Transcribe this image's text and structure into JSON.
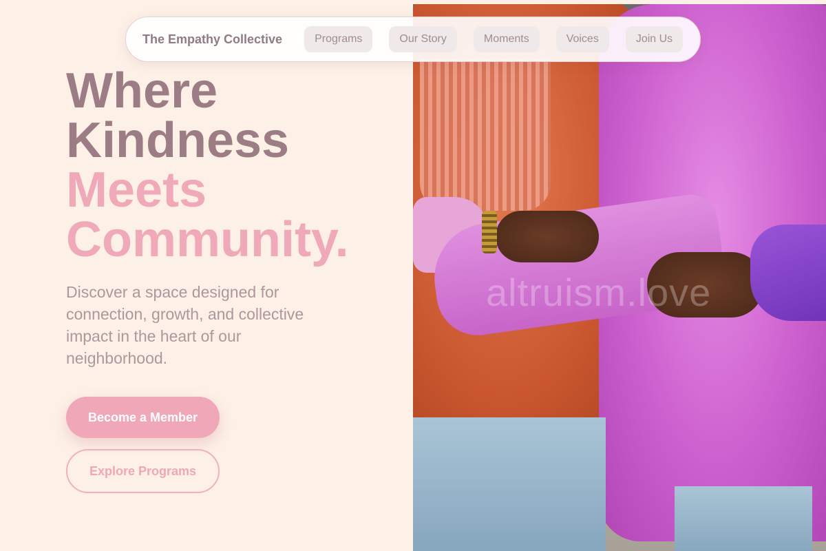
{
  "nav": {
    "brand": "The Empathy Collective",
    "links": [
      "Programs",
      "Our Story",
      "Moments",
      "Voices",
      "Join Us"
    ]
  },
  "hero": {
    "title_lines": [
      "Where",
      "Kindness"
    ],
    "accent_lines": [
      "Meets",
      "Community."
    ],
    "subtitle": "Discover a space designed for connection, growth, and collective impact in the heart of our neighborhood.",
    "primary_cta": "Become a Member",
    "secondary_cta": "Explore Programs"
  },
  "photo": {
    "watermark": "altruism.love"
  },
  "colors": {
    "background": "#fdf0e6",
    "title": "#9c7d86",
    "accent": "#f0a9b9"
  }
}
